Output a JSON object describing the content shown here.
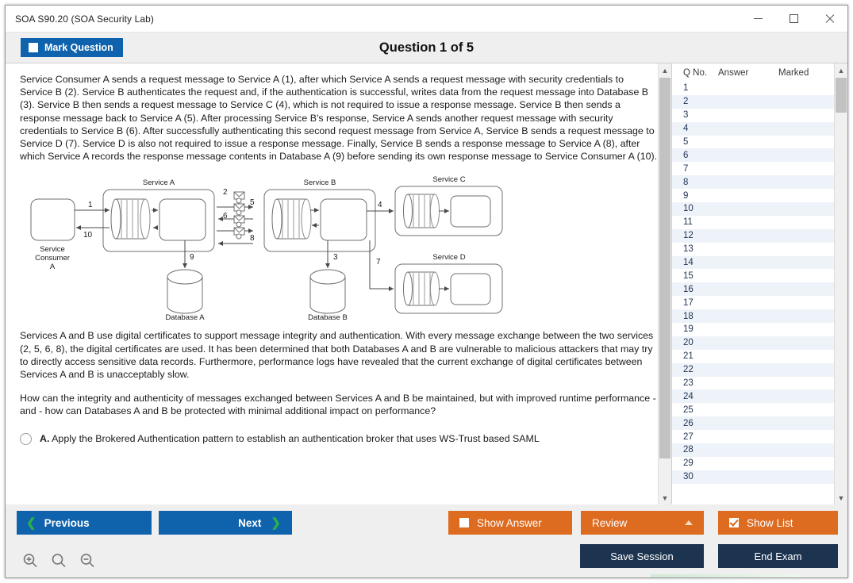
{
  "window": {
    "title": "SOA S90.20 (SOA Security Lab)",
    "minimize_label": "Minimize",
    "maximize_label": "Maximize",
    "close_label": "Close"
  },
  "header": {
    "mark_question_label": "Mark Question",
    "mark_question_checked": false,
    "question_title": "Question 1 of 5"
  },
  "question": {
    "paragraph1": "Service Consumer A sends a request message to Service A (1), after which Service A sends a request message with security credentials to Service B (2). Service B authenticates the request and, if the authentication is successful, writes data from the request message into Database B (3). Service B then sends a request message to Service C (4), which is not required to issue a response message. Service B then sends a response message back to Service A (5). After processing Service B's response, Service A sends another request message with security credentials to Service B (6). After successfully authenticating this second request message from Service A, Service B sends a request message to Service D (7). Service D is also not required to issue a response message. Finally, Service B sends a response message to Service A (8), after which Service A records the response message contents in Database A (9) before sending its own response message to Service Consumer A (10).",
    "paragraph2": "Services A and B use digital certificates to support message integrity and authentication. With every message exchange between the two services (2, 5, 6, 8), the digital certificates are used. It has been determined that both Databases A and B are vulnerable to malicious attackers that may try to directly access sensitive data records. Furthermore, performance logs have revealed that the current exchange of digital certificates between Services A and B is unacceptably slow.",
    "paragraph3": "How can the integrity and authenticity of messages exchanged between Services A and B be maintained, but with improved runtime performance - and - how can Databases A and B be protected with minimal additional impact on performance?",
    "options": [
      {
        "letter": "A.",
        "text": "Apply the Brokered Authentication pattern to establish an authentication broker that uses WS-Trust based SAML",
        "selected": false
      }
    ]
  },
  "diagram": {
    "labels": {
      "service_consumer_a": "Service\nConsumer\nA",
      "service_a": "Service A",
      "service_b": "Service B",
      "service_c": "Service C",
      "service_d": "Service D",
      "database_a": "Database A",
      "database_b": "Database B"
    },
    "flow_numbers": [
      "1",
      "2",
      "3",
      "4",
      "5",
      "6",
      "7",
      "8",
      "9",
      "10"
    ]
  },
  "question_list": {
    "columns": [
      "Q No.",
      "Answer",
      "Marked"
    ],
    "rows": [
      {
        "no": "1",
        "answer": "",
        "marked": ""
      },
      {
        "no": "2",
        "answer": "",
        "marked": ""
      },
      {
        "no": "3",
        "answer": "",
        "marked": ""
      },
      {
        "no": "4",
        "answer": "",
        "marked": ""
      },
      {
        "no": "5",
        "answer": "",
        "marked": ""
      },
      {
        "no": "6",
        "answer": "",
        "marked": ""
      },
      {
        "no": "7",
        "answer": "",
        "marked": ""
      },
      {
        "no": "8",
        "answer": "",
        "marked": ""
      },
      {
        "no": "9",
        "answer": "",
        "marked": ""
      },
      {
        "no": "10",
        "answer": "",
        "marked": ""
      },
      {
        "no": "11",
        "answer": "",
        "marked": ""
      },
      {
        "no": "12",
        "answer": "",
        "marked": ""
      },
      {
        "no": "13",
        "answer": "",
        "marked": ""
      },
      {
        "no": "14",
        "answer": "",
        "marked": ""
      },
      {
        "no": "15",
        "answer": "",
        "marked": ""
      },
      {
        "no": "16",
        "answer": "",
        "marked": ""
      },
      {
        "no": "17",
        "answer": "",
        "marked": ""
      },
      {
        "no": "18",
        "answer": "",
        "marked": ""
      },
      {
        "no": "19",
        "answer": "",
        "marked": ""
      },
      {
        "no": "20",
        "answer": "",
        "marked": ""
      },
      {
        "no": "21",
        "answer": "",
        "marked": ""
      },
      {
        "no": "22",
        "answer": "",
        "marked": ""
      },
      {
        "no": "23",
        "answer": "",
        "marked": ""
      },
      {
        "no": "24",
        "answer": "",
        "marked": ""
      },
      {
        "no": "25",
        "answer": "",
        "marked": ""
      },
      {
        "no": "26",
        "answer": "",
        "marked": ""
      },
      {
        "no": "27",
        "answer": "",
        "marked": ""
      },
      {
        "no": "28",
        "answer": "",
        "marked": ""
      },
      {
        "no": "29",
        "answer": "",
        "marked": ""
      },
      {
        "no": "30",
        "answer": "",
        "marked": ""
      }
    ]
  },
  "footer": {
    "previous_label": "Previous",
    "next_label": "Next",
    "show_answer_label": "Show Answer",
    "show_answer_checked": false,
    "review_label": "Review",
    "show_list_label": "Show List",
    "show_list_checked": true,
    "save_session_label": "Save Session",
    "end_exam_label": "End Exam",
    "zoom_in_label": "Zoom In",
    "zoom_reset_label": "Zoom Reset",
    "zoom_out_label": "Zoom Out"
  },
  "colors": {
    "primary_blue": "#0f62ac",
    "accent_orange": "#dd6b20",
    "navy": "#1d3451",
    "chevron_green": "#2bb24c",
    "row_alt": "#eef3f9"
  }
}
